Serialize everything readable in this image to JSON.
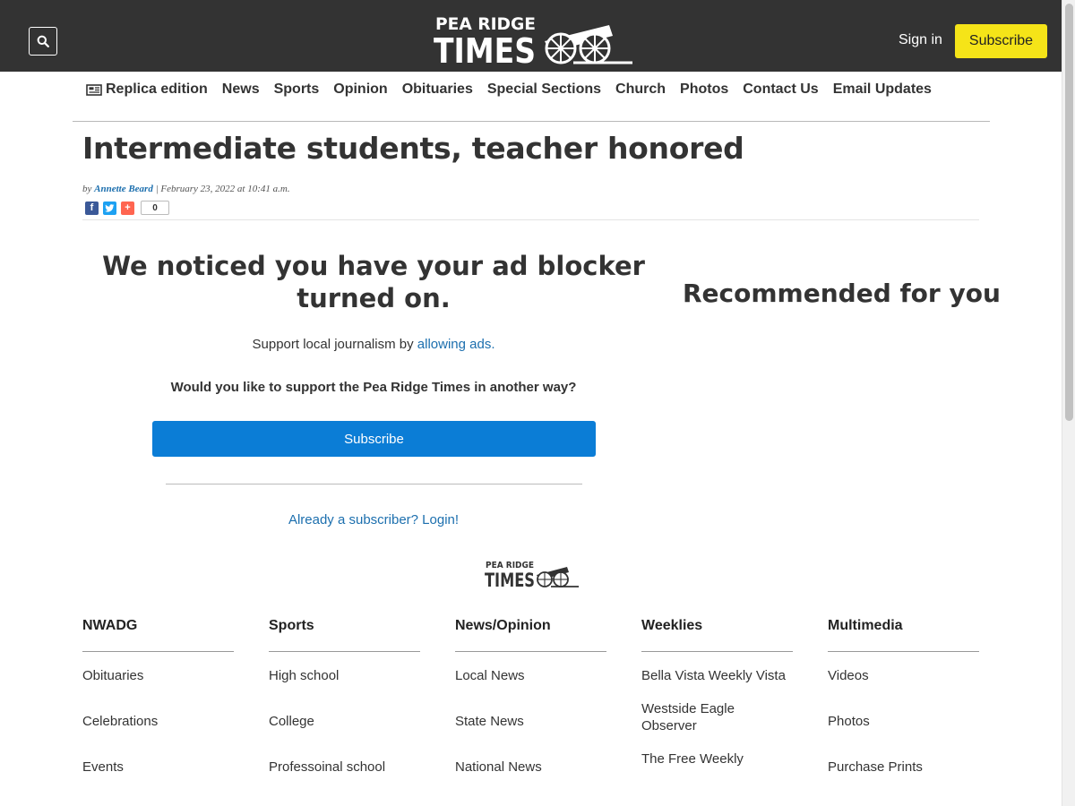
{
  "header": {
    "site_name_line1": "PEA RIDGE",
    "site_name_line2": "TIMES",
    "sign_in": "Sign in",
    "subscribe": "Subscribe",
    "subscribe_bg": "#f5e418",
    "bar_bg": "#333333"
  },
  "nav": {
    "replica": "Replica edition",
    "items": [
      "News",
      "Sports",
      "Opinion",
      "Obituaries",
      "Special Sections",
      "Church",
      "Photos",
      "Contact Us",
      "Email Updates"
    ]
  },
  "article": {
    "headline": "Intermediate students, teacher honored",
    "by": "by",
    "author": "Annette Beard",
    "date": "| February 23, 2022 at 10:41 a.m.",
    "share_count": "0"
  },
  "adblock": {
    "title": "We noticed you have your ad blocker turned on.",
    "support_prefix": "Support local journalism by ",
    "support_link": "allowing ads.",
    "question": "Would you like to support the Pea Ridge Times in another way?",
    "subscribe": "Subscribe",
    "login": "Already a subscriber? Login!",
    "button_color": "#0b7dd6",
    "link_color": "#1c6fae"
  },
  "sidebar": {
    "recommended": "Recommended for you"
  },
  "footer": {
    "columns": [
      {
        "heading": "NWADG",
        "links": [
          "Obituaries",
          "Celebrations",
          "Events"
        ]
      },
      {
        "heading": "Sports",
        "links": [
          "High school",
          "College",
          "Professoinal school"
        ]
      },
      {
        "heading": "News/Opinion",
        "links": [
          "Local News",
          "State News",
          "National News"
        ]
      },
      {
        "heading": "Weeklies",
        "links": [
          "Bella Vista Weekly Vista",
          "Westside Eagle Observer",
          "The Free Weekly"
        ]
      },
      {
        "heading": "Multimedia",
        "links": [
          "Videos",
          "Photos",
          "Purchase Prints"
        ]
      }
    ]
  }
}
